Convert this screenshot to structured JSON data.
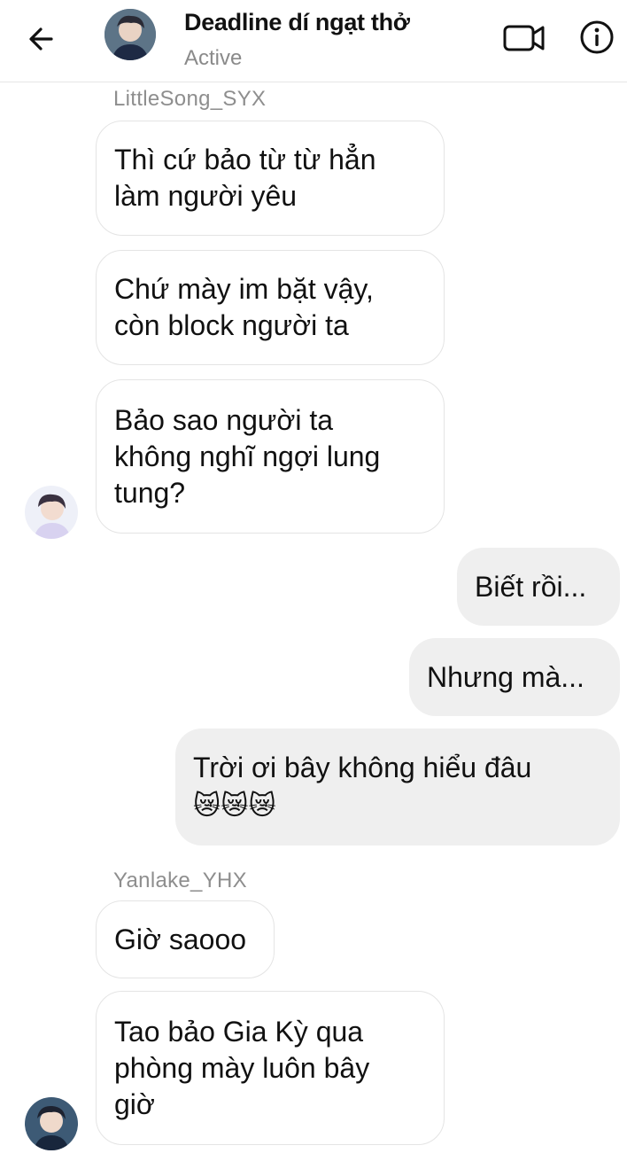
{
  "header": {
    "title": "Deadline dí ngạt thở",
    "status": "Active"
  },
  "messages": [
    {
      "sender": "LittleSong_SYX"
    },
    {
      "text": "Thì cứ bảo từ từ hẳn\nlàm người yêu"
    },
    {
      "text": "Chứ mày im bặt vậy,\ncòn block người ta"
    },
    {
      "text": "Bảo sao người ta\nkhông nghĩ ngợi lung\ntung?"
    },
    {
      "text": "Biết rồi..."
    },
    {
      "text": "Nhưng mà..."
    },
    {
      "text": "Trời ơi bây không hiểu đâu",
      "emoji": "😿😿😿"
    },
    {
      "sender": "Yanlake_YHX"
    },
    {
      "text": "Giờ saooo"
    },
    {
      "text": "Tao bảo Gia Kỳ qua\nphòng mày luôn bây\ngiờ"
    }
  ],
  "colors": {
    "accent": "#111111",
    "outgoing_bubble": "#efefef",
    "muted": "#8e8e8e"
  },
  "icons": [
    "back-arrow-icon",
    "video-call-icon",
    "info-icon"
  ]
}
